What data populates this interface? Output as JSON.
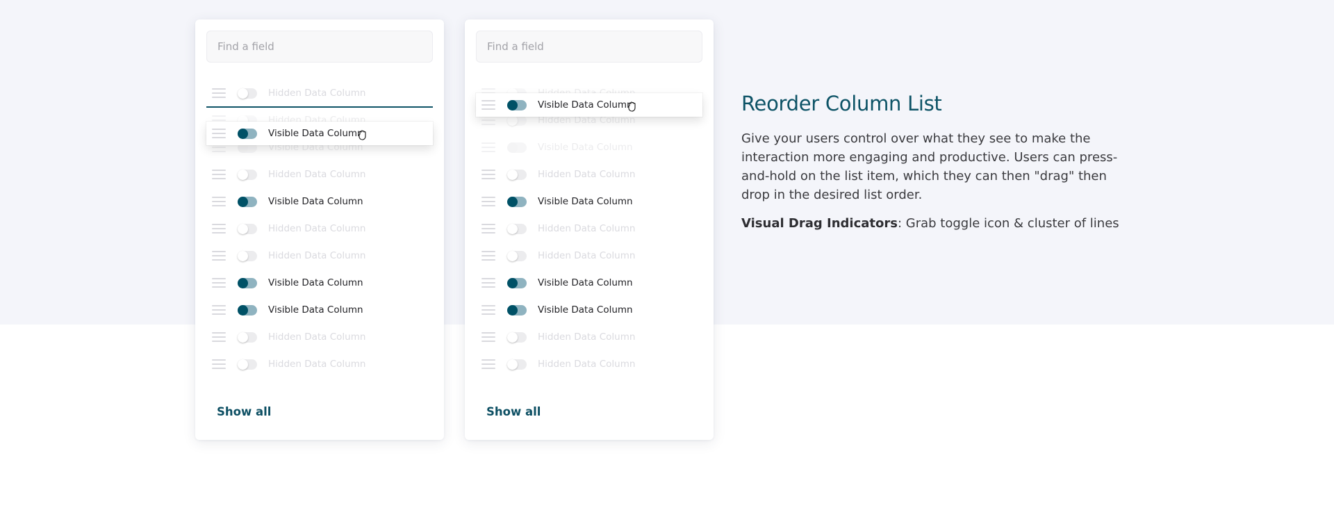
{
  "section": {
    "title": "Reorder Column List",
    "description": "Give your users control over what they see to make the interaction more engaging and productive. Users can press-and-hold on the list item, which they can then \"drag\" then drop in the desired list order.",
    "indicators_label": "Visual Drag Indicators",
    "indicators_text": ": Grab toggle icon & cluster of lines"
  },
  "cards": [
    {
      "search_placeholder": "Find a field",
      "show_all_label": "Show all",
      "dragged_item": {
        "label": "Visible Data Column",
        "visible": true
      },
      "items": [
        {
          "label": "Hidden Data Column",
          "visible": false
        },
        {
          "label": "Hidden Data Column",
          "visible": false
        },
        {
          "label": "Visible Data Column",
          "visible": true
        },
        {
          "label": "Hidden Data Column",
          "visible": false
        },
        {
          "label": "Visible Data Column",
          "visible": true
        },
        {
          "label": "Hidden Data Column",
          "visible": false
        },
        {
          "label": "Hidden Data Column",
          "visible": false
        },
        {
          "label": "Visible Data Column",
          "visible": true
        },
        {
          "label": "Visible Data Column",
          "visible": true
        },
        {
          "label": "Hidden Data Column",
          "visible": false
        },
        {
          "label": "Hidden Data Column",
          "visible": false
        }
      ]
    },
    {
      "search_placeholder": "Find a field",
      "show_all_label": "Show all",
      "dragged_item": {
        "label": "Visible Data Column",
        "visible": true
      },
      "items": [
        {
          "label": "Hidden Data Column",
          "visible": false
        },
        {
          "label": "Hidden Data Column",
          "visible": false
        },
        {
          "label": "Visible Data Column",
          "visible": true
        },
        {
          "label": "Hidden Data Column",
          "visible": false
        },
        {
          "label": "Visible Data Column",
          "visible": true
        },
        {
          "label": "Hidden Data Column",
          "visible": false
        },
        {
          "label": "Hidden Data Column",
          "visible": false
        },
        {
          "label": "Visible Data Column",
          "visible": true
        },
        {
          "label": "Visible Data Column",
          "visible": true
        },
        {
          "label": "Hidden Data Column",
          "visible": false
        },
        {
          "label": "Hidden Data Column",
          "visible": false
        }
      ]
    }
  ],
  "colors": {
    "accent": "#0d5366",
    "toggle_on_track": "#8fb3c0",
    "toggle_on_knob": "#005166",
    "background_band": "#f4f5fa"
  }
}
